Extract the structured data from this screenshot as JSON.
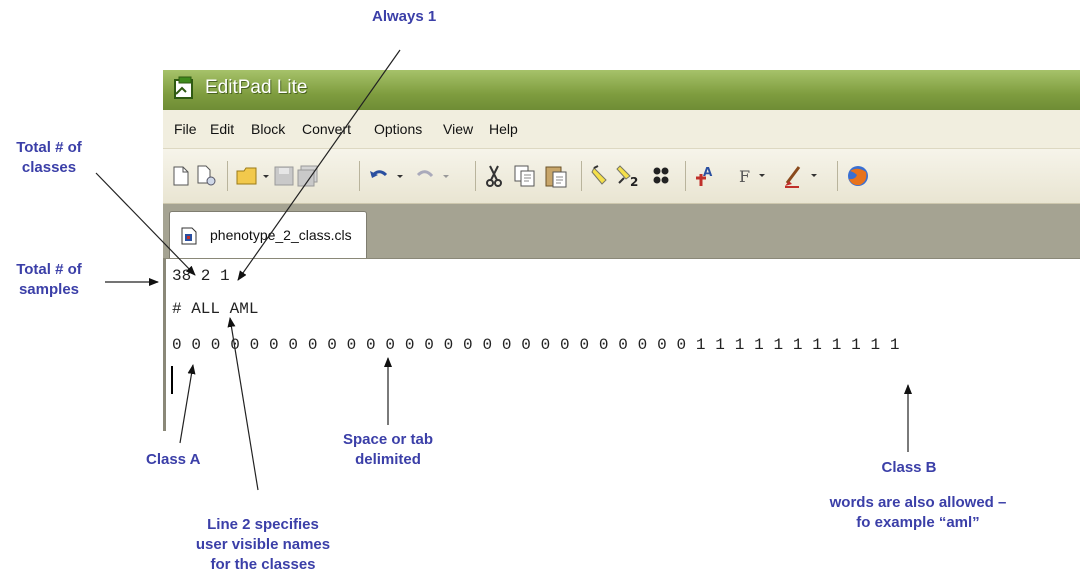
{
  "window": {
    "title": "EditPad Lite",
    "menu": [
      "File",
      "Edit",
      "Block",
      "Convert",
      "Options",
      "View",
      "Help"
    ],
    "tab_label": "phenotype_2_class.cls"
  },
  "toolbar_icons": [
    "new-file-icon",
    "new-from-template-icon",
    "open-folder-icon",
    "save-icon",
    "save-all-icon",
    "undo-icon",
    "redo-icon",
    "cut-icon",
    "copy-icon",
    "paste-icon",
    "marker-icon",
    "spell-icon",
    "bullets-icon",
    "font-icon",
    "text-format-icon",
    "brush-icon",
    "browser-icon"
  ],
  "editor": {
    "lines": [
      "38 2 1",
      "# ALL AML",
      "0 0 0 0 0 0 0 0 0 0 0 0 0 0 0 0 0 0 0 0 0 0 0 0 0 0 0 1 1 1 1 1 1 1 1 1 1 1"
    ]
  },
  "annotations": {
    "always_1": "Always 1",
    "total_classes_1": "Total # of",
    "total_classes_2": "classes",
    "total_samples_1": "Total # of",
    "total_samples_2": "samples",
    "class_a": "Class A",
    "space_tab_1": "Space or tab",
    "space_tab_2": "delimited",
    "class_b": "Class B",
    "words_1": "words are also allowed –",
    "words_2": "fo example “aml”",
    "line2_1": "Line 2 specifies",
    "line2_2": "user visible names",
    "line2_3": "for the classes"
  },
  "colors": {
    "annotation": "#3b3fa8",
    "titlebar": "#7f9d3f",
    "menubar": "#f1eedf",
    "tabstrip": "#a5a392"
  }
}
